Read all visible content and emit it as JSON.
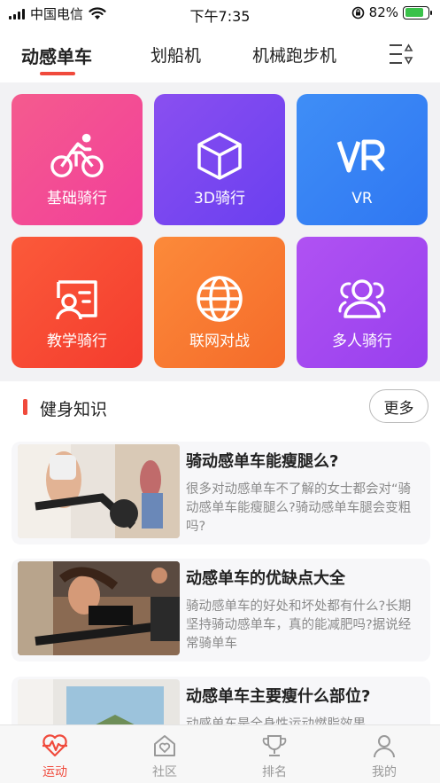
{
  "status_bar": {
    "carrier": "中国电信",
    "time": "下午7:35",
    "battery_percent": "82%",
    "battery_level": 0.82
  },
  "tabs": [
    {
      "label": "动感单车",
      "active": true
    },
    {
      "label": "划船机",
      "active": false
    },
    {
      "label": "机械跑步机",
      "active": false
    }
  ],
  "modes": [
    {
      "label": "基础骑行",
      "icon": "bike-icon",
      "gradient": [
        "#f45b8e",
        "#f23f9a"
      ]
    },
    {
      "label": "3D骑行",
      "icon": "cube-icon",
      "gradient": [
        "#8a4ff0",
        "#6a3ff0"
      ]
    },
    {
      "label": "VR",
      "icon": "vr-icon",
      "gradient": [
        "#3f8ef6",
        "#2f77f2"
      ]
    },
    {
      "label": "教学骑行",
      "icon": "teaching-icon",
      "gradient": [
        "#fb5a3a",
        "#f43c2e"
      ]
    },
    {
      "label": "联网对战",
      "icon": "globe-icon",
      "gradient": [
        "#fc8a3a",
        "#f56b2a"
      ]
    },
    {
      "label": "多人骑行",
      "icon": "group-icon",
      "gradient": [
        "#b052f2",
        "#9840ee"
      ]
    }
  ],
  "knowledge": {
    "title": "健身知识",
    "more_label": "更多",
    "articles": [
      {
        "title": "骑动感单车能瘦腿么?",
        "desc": "很多对动感单车不了解的女士都会对“骑动感单车能瘦腿么?骑动感单车腿会变粗吗?"
      },
      {
        "title": "动感单车的优缺点大全",
        "desc": "骑动感单车的好处和坏处都有什么?长期坚持骑动感单车，真的能减肥吗?据说经常骑单车"
      },
      {
        "title": "动感单车主要瘦什么部位?",
        "desc": "动感单车是全身性运动燃脂效果"
      }
    ]
  },
  "bottom_nav": [
    {
      "label": "运动",
      "icon": "pulse-heart-icon",
      "active": true
    },
    {
      "label": "社区",
      "icon": "community-icon",
      "active": false
    },
    {
      "label": "排名",
      "icon": "trophy-icon",
      "active": false
    },
    {
      "label": "我的",
      "icon": "user-icon",
      "active": false
    }
  ],
  "colors": {
    "accent": "#f04a3c",
    "grid_background": "#f2f2f4",
    "nav_inactive": "#999999"
  }
}
